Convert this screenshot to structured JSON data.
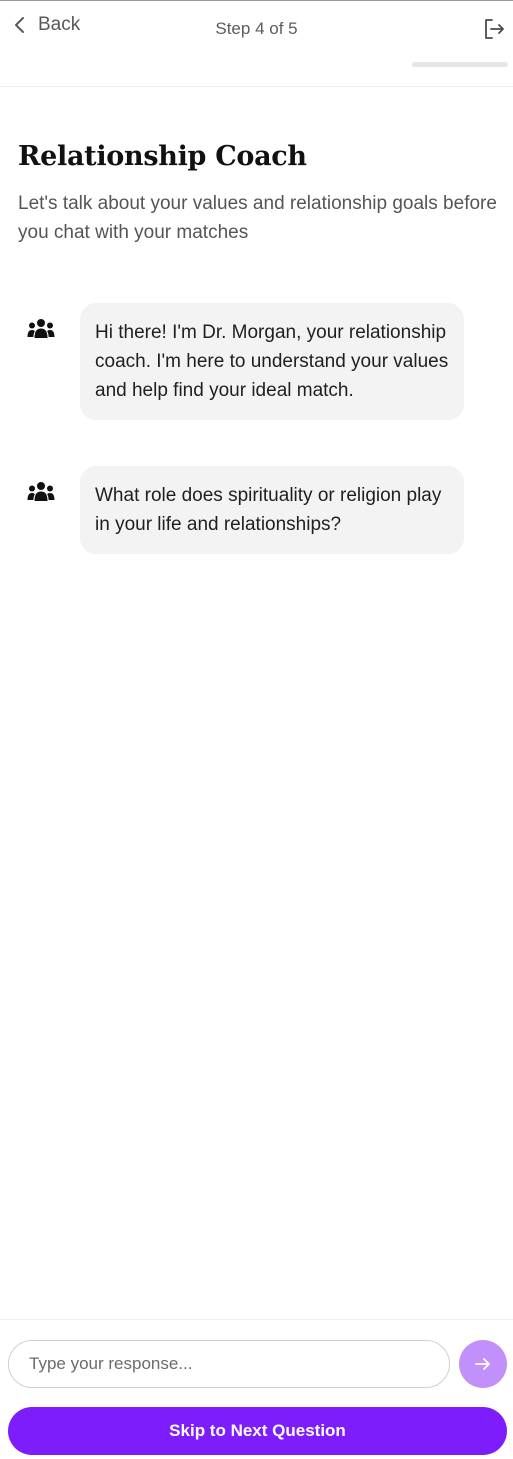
{
  "header": {
    "back_label": "Back",
    "step_text": "Step 4 of 5",
    "progress_fraction": 0.8
  },
  "intro": {
    "title": "Relationship Coach",
    "subtitle": "Let's talk about your values and relationship goals before you chat with your matches"
  },
  "messages": [
    {
      "sender_icon": "people-group-icon",
      "text": "Hi there! I'm Dr. Morgan, your relationship coach. I'm here to understand your values and help find your ideal match."
    },
    {
      "sender_icon": "people-group-icon",
      "text": "What role does spirituality or religion play in your life and relationships?"
    }
  ],
  "composer": {
    "placeholder": "Type your response...",
    "value": "",
    "send_icon": "arrow-right-icon"
  },
  "actions": {
    "skip_label": "Skip to Next Question"
  },
  "colors": {
    "accent": "#7d1dfb",
    "send_button": "#c190fb",
    "bubble": "#f3f3f3"
  }
}
